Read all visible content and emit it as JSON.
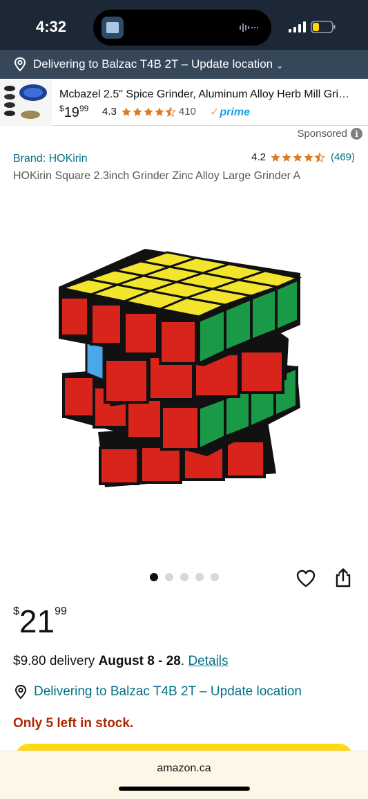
{
  "status_bar": {
    "time": "4:32"
  },
  "location_bar": {
    "text": "Delivering to Balzac T4B 2T – Update location"
  },
  "sponsored_ad": {
    "title": "Mcbazel 2.5\" Spice Grinder, Aluminum Alloy Herb Mill Gri…",
    "price_symbol": "$",
    "price_whole": "19",
    "price_cents": "99",
    "rating": "4.3",
    "rating_count": "410",
    "prime_label": "prime"
  },
  "sponsored_label": "Sponsored",
  "product": {
    "brand": "Brand: HOKirin",
    "rating": "4.2",
    "rating_count": "(469)",
    "title": "HOKirin Square 2.3inch Grinder Zinc Alloy Large Grinder A",
    "image_count": 5,
    "active_image": 1,
    "price_symbol": "$",
    "price_whole": "21",
    "price_cents": "99"
  },
  "delivery": {
    "fee": "$9.80 delivery",
    "dates": "August 8 - 28",
    "sep": ".",
    "details_link": "Details",
    "location": "Delivering to Balzac T4B 2T – Update location"
  },
  "stock": "Only 5 left in stock.",
  "browser": {
    "domain": "amazon.ca"
  },
  "colors": {
    "link": "#007185",
    "stock_red": "#b12704",
    "star": "#de7921",
    "buy_button": "#ffd814",
    "header": "#37475a"
  }
}
